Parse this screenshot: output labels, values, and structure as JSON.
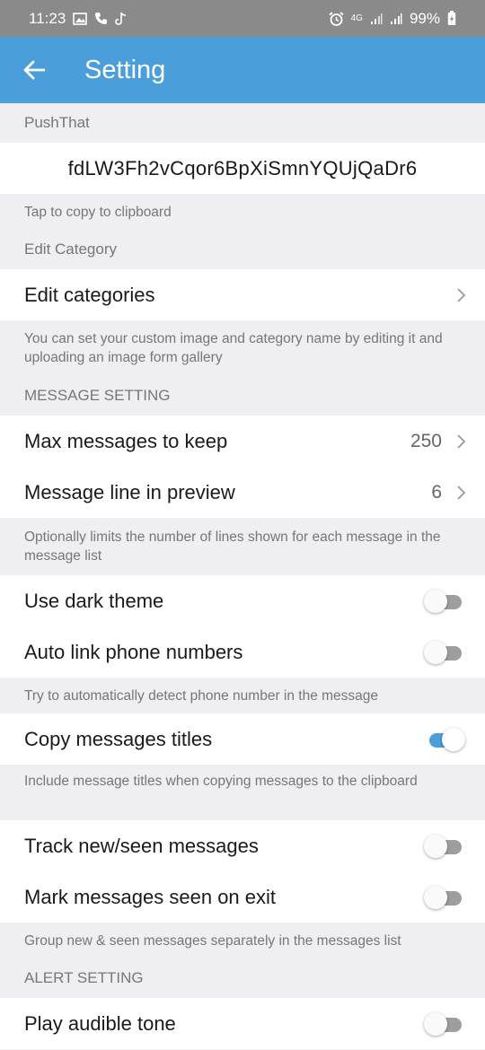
{
  "status_bar": {
    "time": "11:23",
    "network": "4G",
    "battery": "99%"
  },
  "app_bar": {
    "title": "Setting"
  },
  "sections": {
    "pushthat": {
      "header": "PushThat",
      "token": "fdLW3Fh2vCqor6BpXiSmnYQUjQaDr6",
      "hint": "Tap to copy to clipboard"
    },
    "edit_category": {
      "header": "Edit Category",
      "row_label": "Edit categories",
      "hint": "You can set your custom image and category name by editing it and uploading an image form gallery"
    },
    "message_setting": {
      "header": "MESSAGE SETTING",
      "max_messages_label": "Max messages to keep",
      "max_messages_value": "250",
      "preview_lines_label": "Message line in preview",
      "preview_lines_value": "6",
      "hint": "Optionally limits the number of lines shown for each message in the message list"
    },
    "display": {
      "dark_theme_label": "Use dark theme",
      "dark_theme_on": false,
      "auto_link_label": "Auto link phone numbers",
      "auto_link_on": false,
      "hint": "Try to automatically detect phone number in the message"
    },
    "copy": {
      "copy_titles_label": "Copy messages titles",
      "copy_titles_on": true,
      "hint": "Include message titles when copying messages to the clipboard"
    },
    "tracking": {
      "track_label": "Track new/seen messages",
      "track_on": false,
      "mark_seen_label": "Mark messages seen on exit",
      "mark_seen_on": false,
      "hint": "Group new & seen messages separately in the messages list"
    },
    "alert_setting": {
      "header": "ALERT SETTING",
      "tone_label": "Play audible tone",
      "tone_on": false
    }
  },
  "colors": {
    "accent": "#4a9fda",
    "toggle_off": "#9e9e9e"
  }
}
